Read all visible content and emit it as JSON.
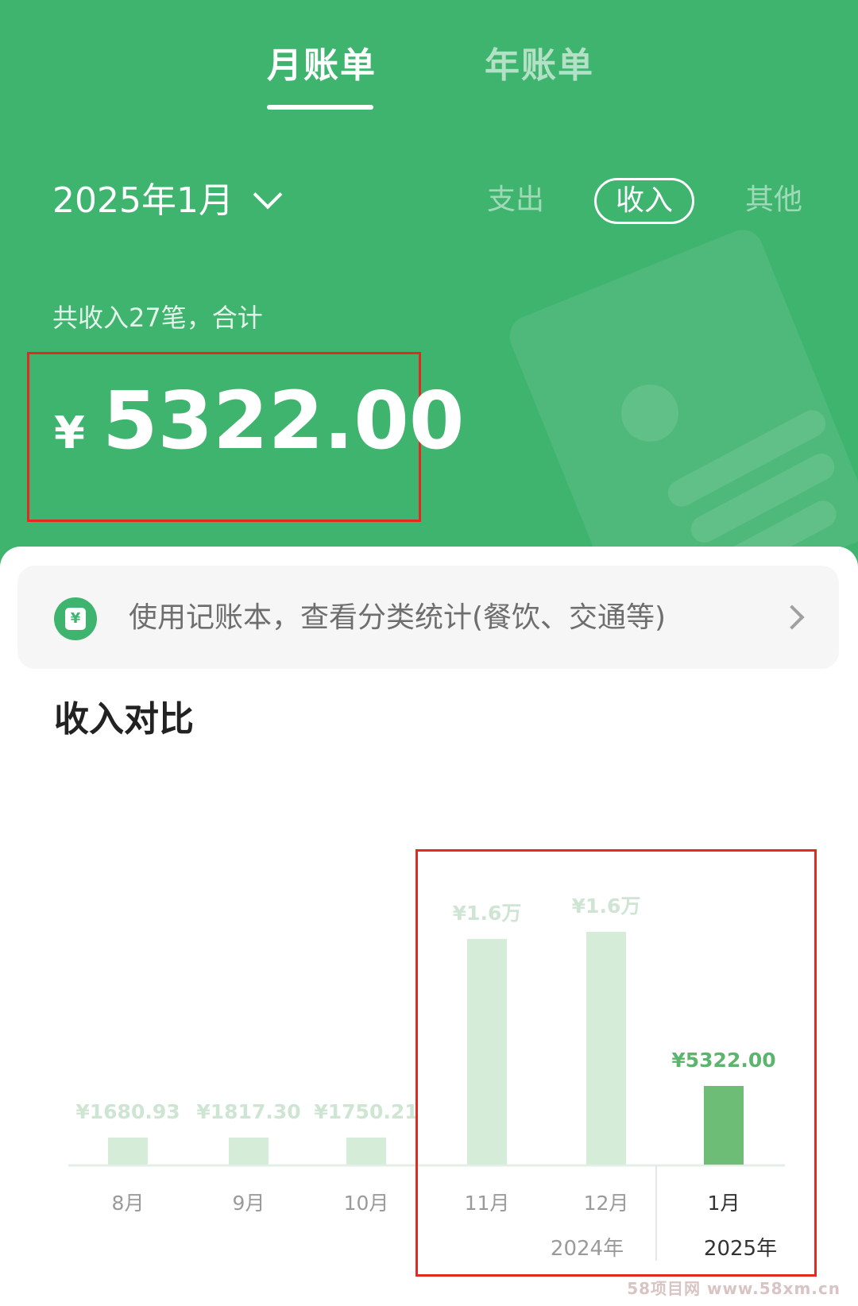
{
  "tabs": {
    "monthly": "月账单",
    "yearly": "年账单"
  },
  "month_picker": {
    "label": "2025年1月"
  },
  "filters": {
    "expense": "支出",
    "income": "收入",
    "other": "其他"
  },
  "summary": {
    "label": "共收入27笔，合计",
    "currency": "¥",
    "amount": "5322.00"
  },
  "promo": {
    "text": "使用记账本，查看分类统计(餐饮、交通等)"
  },
  "section_title": "收入对比",
  "chart_data": {
    "type": "bar",
    "categories": [
      "8月",
      "9月",
      "10月",
      "11月",
      "12月",
      "1月"
    ],
    "values": [
      1680.93,
      1817.3,
      1750.21,
      16000,
      16500,
      5322.0
    ],
    "value_labels": [
      "¥1680.93",
      "¥1817.30",
      "¥1750.21",
      "¥1.6万",
      "¥1.6万",
      "¥5322.00"
    ],
    "year_groups": [
      {
        "label": "2024年",
        "categories": [
          "8月",
          "9月",
          "10月",
          "11月",
          "12月"
        ]
      },
      {
        "label": "2025年",
        "categories": [
          "1月"
        ]
      }
    ],
    "active_index": 5,
    "colors": {
      "inactive_bar": "#d5ecd9",
      "active_bar": "#6dbd77",
      "inactive_label": "#cfe5d3",
      "active_label": "#5cb56c"
    }
  },
  "watermark": "58项目网 www.58xm.cn"
}
